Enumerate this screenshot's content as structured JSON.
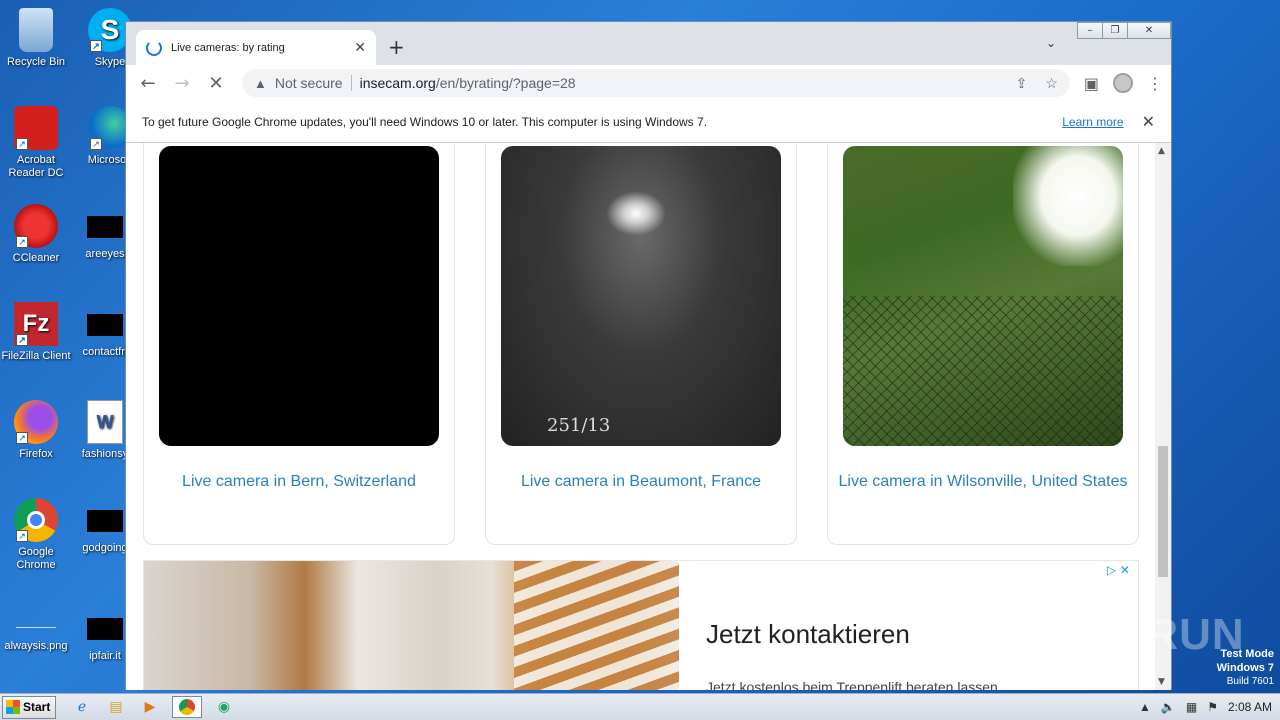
{
  "desktop": {
    "icons": [
      {
        "label": "Recycle Bin"
      },
      {
        "label": "Skype"
      },
      {
        "label": "Acrobat Reader DC"
      },
      {
        "label": "Microsoft"
      },
      {
        "label": "CCleaner"
      },
      {
        "label": "areeyes"
      },
      {
        "label": "FileZilla Client"
      },
      {
        "label": "contactfri"
      },
      {
        "label": "Firefox"
      },
      {
        "label": "fashionsy"
      },
      {
        "label": "Google Chrome"
      },
      {
        "label": "godgoing"
      },
      {
        "label": "alwaysis.png"
      },
      {
        "label": "ipfair.it"
      }
    ],
    "watermark": "ANY RUN",
    "test_mode": {
      "line1": "Test Mode",
      "line2": "Windows 7",
      "line3": "Build 7601"
    }
  },
  "browser": {
    "tab_title": "Live cameras: by rating",
    "address": {
      "security_label": "Not secure",
      "host": "insecam.org",
      "path": "/en/byrating/?page=28"
    },
    "infobar": {
      "message": "To get future Google Chrome updates, you'll need Windows 10 or later. This computer is using Windows 7.",
      "link": "Learn more"
    }
  },
  "page": {
    "cameras": [
      {
        "caption": "Live camera in Bern, Switzerland",
        "style": "black"
      },
      {
        "caption": "Live camera in Beaumont, France",
        "style": "night",
        "stamp": "251/13"
      },
      {
        "caption": "Live camera in Wilsonville, United States",
        "style": "garden"
      }
    ],
    "ad": {
      "headline": "Jetzt kontaktieren",
      "sub": "Jetzt kostenlos beim Treppenlift beraten lassen"
    }
  },
  "taskbar": {
    "start_label": "Start",
    "clock": "2:08 AM"
  }
}
